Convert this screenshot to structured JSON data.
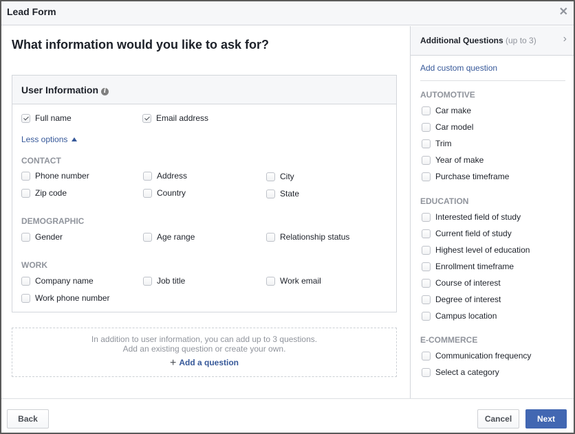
{
  "window": {
    "title": "Lead Form"
  },
  "main": {
    "heading": "What information would you like to ask for?",
    "user_info": {
      "title": "User Information",
      "default_fields": [
        {
          "label": "Full name",
          "checked": true
        },
        {
          "label": "Email address",
          "checked": true
        }
      ],
      "toggle_label": "Less options",
      "sections": [
        {
          "label": "CONTACT",
          "fields": [
            "Phone number",
            "Address",
            "City",
            "Zip code",
            "Country",
            "State"
          ]
        },
        {
          "label": "DEMOGRAPHIC",
          "fields": [
            "Gender",
            "Age range",
            "Relationship status"
          ]
        },
        {
          "label": "WORK",
          "fields": [
            "Company name",
            "Job title",
            "Work email",
            "Work phone number"
          ]
        }
      ]
    },
    "add_box": {
      "line1": "In addition to user information, you can add up to 3 questions.",
      "line2": "Add an existing question or create your own.",
      "add_label": "Add a question"
    }
  },
  "side": {
    "title": "Additional Questions",
    "title_note": "(up to 3)",
    "add_custom": "Add custom question",
    "sections": [
      {
        "label": "AUTOMOTIVE",
        "fields": [
          "Car make",
          "Car model",
          "Trim",
          "Year of make",
          "Purchase timeframe"
        ]
      },
      {
        "label": "EDUCATION",
        "fields": [
          "Interested field of study",
          "Current field of study",
          "Highest level of education",
          "Enrollment timeframe",
          "Course of interest",
          "Degree of interest",
          "Campus location"
        ]
      },
      {
        "label": "E-COMMERCE",
        "fields": [
          "Communication frequency",
          "Select a category"
        ]
      }
    ]
  },
  "footer": {
    "back": "Back",
    "cancel": "Cancel",
    "next": "Next"
  },
  "colors": {
    "primary": "#4267b2",
    "link": "#365899",
    "muted": "#90949c"
  }
}
